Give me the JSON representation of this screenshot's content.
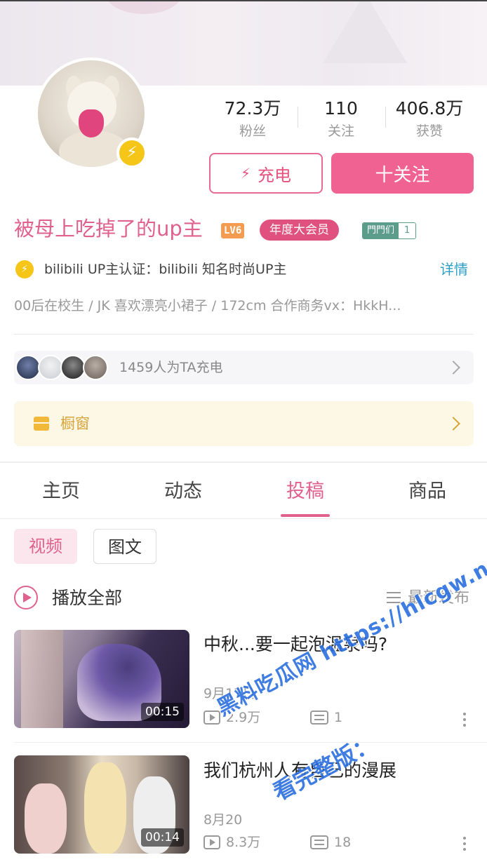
{
  "stats": [
    {
      "value": "72.3万",
      "label": "粉丝"
    },
    {
      "value": "110",
      "label": "关注"
    },
    {
      "value": "406.8万",
      "label": "获赞"
    }
  ],
  "actions": {
    "charge_label": "充电",
    "follow_label": "十关注"
  },
  "profile": {
    "name": "被母上吃掉了的up主",
    "level": "LV6",
    "vip": "年度大会员",
    "medal_name": "門門们",
    "medal_level": "1",
    "cert": "bilibili UP主认证：bilibili 知名时尚UP主",
    "detail_link": "详情",
    "signature": "00后在校生 / JK 喜欢漂亮小裙子 / 172cm 合作商务vx：HkkH..."
  },
  "charge": {
    "text": "1459人为TA充电"
  },
  "shop": {
    "label": "橱窗"
  },
  "tabs": [
    "主页",
    "动态",
    "投稿",
    "商品"
  ],
  "active_tab": "投稿",
  "filters": [
    "视频",
    "图文"
  ],
  "list_header": {
    "play_all": "播放全部",
    "sort": "最新发布"
  },
  "videos": [
    {
      "title": "中秋...要一起泡温泉吗?",
      "date": "9月17日",
      "views": "2.9万",
      "danmaku": "1",
      "duration": "00:15"
    },
    {
      "title": "我们杭州人有自己的漫展",
      "date": "8月20",
      "views": "8.3万",
      "danmaku": "18",
      "duration": "00:14"
    }
  ],
  "watermark": {
    "line1": "黑料吃瓜网 https://hlcgw.net",
    "line2": "看完整版："
  },
  "colors": {
    "accent": "#f06292",
    "name": "#e0628c",
    "vip": "#e0517f",
    "cert": "#f5c518",
    "link": "#2d9fc7"
  }
}
